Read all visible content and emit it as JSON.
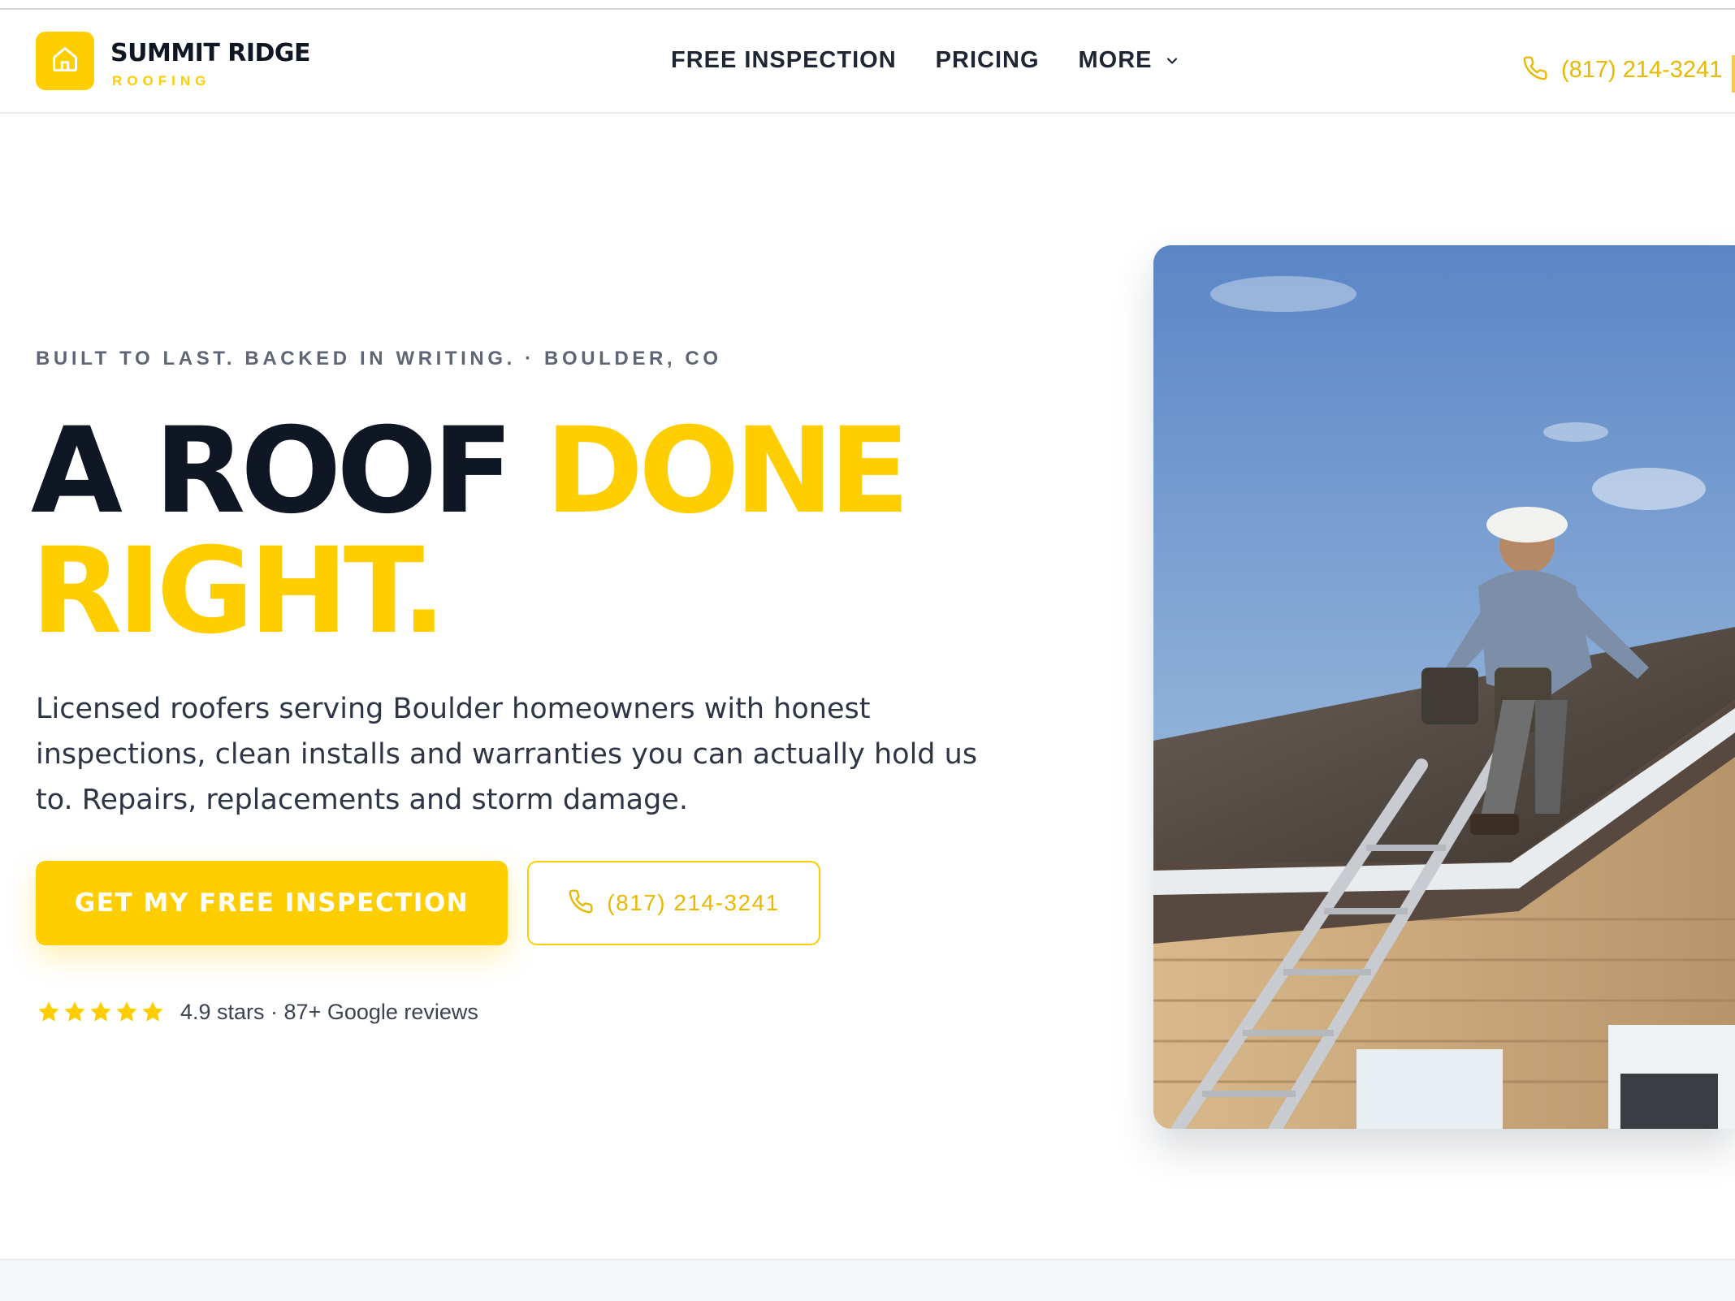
{
  "brand": {
    "name": "SUMMIT RIDGE",
    "tagline": "ROOFING",
    "icon": "home-icon",
    "accent_color": "#ffce00",
    "dark_color": "#0f1624"
  },
  "nav": {
    "items": [
      {
        "label": "FREE INSPECTION"
      },
      {
        "label": "PRICING"
      },
      {
        "label": "MORE",
        "icon": "chevron-down-icon"
      }
    ]
  },
  "header_phone": {
    "icon": "phone-icon",
    "number": "(817) 214-3241"
  },
  "hero": {
    "eyebrow": "BUILT TO LAST. BACKED IN WRITING. · BOULDER, CO",
    "headline_part1": "A ROOF ",
    "headline_accent_1": "DONE",
    "headline_accent_2": "RIGHT.",
    "lead": "Licensed roofers serving Boulder homeowners with honest inspections, clean installs and warranties you can actually hold us to. Repairs, replacements and storm damage.",
    "primary_cta": "GET MY FREE INSPECTION",
    "secondary_cta": {
      "icon": "phone-icon",
      "number": "(817) 214-3241"
    },
    "rating": {
      "stars": 5,
      "icon": "star-icon",
      "text": "4.9 stars · 87+ Google reviews"
    },
    "image": "roofer-on-ladder-photo"
  }
}
